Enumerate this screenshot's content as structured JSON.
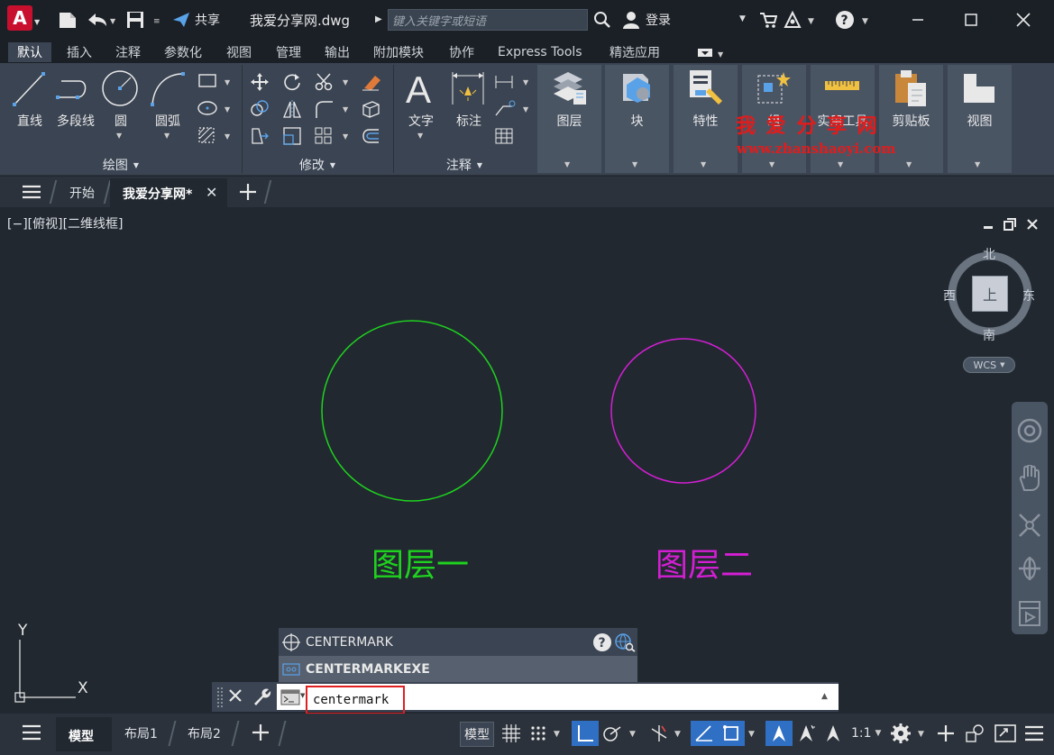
{
  "titlebar": {
    "app_badge": "A",
    "share_label": "共享",
    "file_name": "我爱分享网.dwg",
    "search_placeholder": "键入关键字或短语",
    "login_label": "登录"
  },
  "ribbon_tabs": [
    "默认",
    "插入",
    "注释",
    "参数化",
    "视图",
    "管理",
    "输出",
    "附加模块",
    "协作",
    "Express Tools",
    "精选应用"
  ],
  "ribbon": {
    "draw": {
      "title": "绘图",
      "tools": [
        "直线",
        "多段线",
        "圆",
        "圆弧"
      ]
    },
    "modify": {
      "title": "修改"
    },
    "annotation": {
      "title": "注释",
      "tools": [
        "文字",
        "标注"
      ]
    },
    "panels": [
      "图层",
      "块",
      "特性",
      "组",
      "实用工具",
      "剪贴板",
      "视图"
    ]
  },
  "watermark": {
    "title": "我 爱 分 享 网",
    "url": "www.zhanshaoyi.com"
  },
  "doc_tabs": {
    "start": "开始",
    "current": "我爱分享网*"
  },
  "viewport": {
    "label": "[−][俯视][二维线框]",
    "layer1_text": "图层一",
    "layer2_text": "图层二",
    "layer1_color": "#1fd21f",
    "layer2_color": "#d31fd3"
  },
  "viewcube": {
    "north": "北",
    "south": "南",
    "east": "东",
    "west": "西",
    "face": "上",
    "wcs": "WCS"
  },
  "ucs": {
    "x": "X",
    "y": "Y"
  },
  "command": {
    "suggestions": [
      "CENTERMARK",
      "CENTERMARKEXE"
    ],
    "input_value": "centermark"
  },
  "statusbar": {
    "tabs": [
      "模型",
      "布局1",
      "布局2"
    ],
    "model_button": "模型",
    "scale": "1:1"
  }
}
